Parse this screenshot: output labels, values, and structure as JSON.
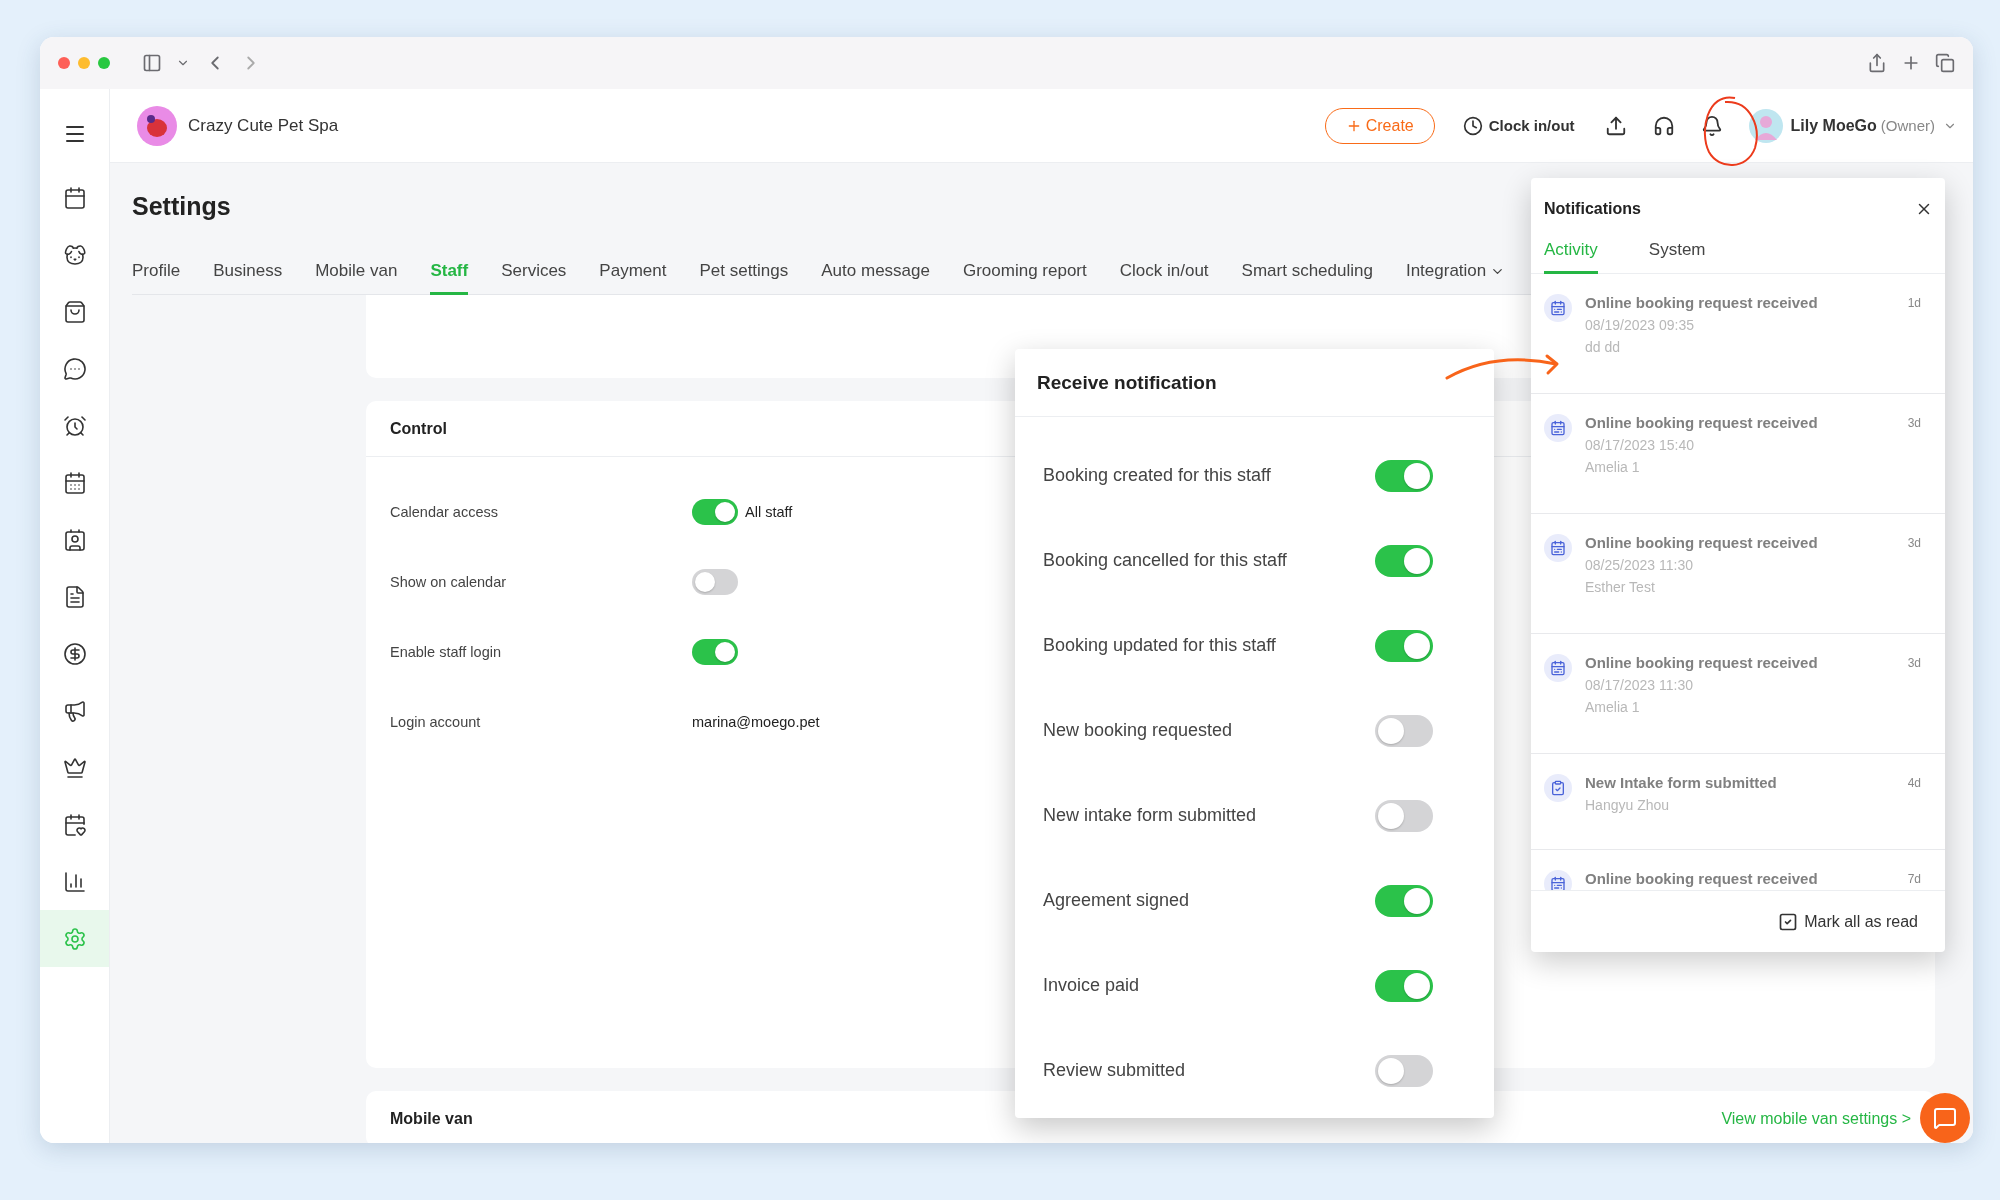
{
  "header": {
    "business_name": "Crazy Cute Pet Spa",
    "create_button": "Create",
    "clock_button": "Clock in/out",
    "user": {
      "name": "Lily MoeGo",
      "role": "(Owner)"
    }
  },
  "sidebar": {
    "items": [
      {
        "selected": false
      },
      {
        "selected": false
      },
      {
        "selected": false
      },
      {
        "selected": false
      },
      {
        "selected": false
      },
      {
        "selected": false
      },
      {
        "selected": false
      },
      {
        "selected": false
      },
      {
        "selected": false
      },
      {
        "selected": false
      },
      {
        "selected": false
      },
      {
        "selected": false
      },
      {
        "selected": false
      },
      {
        "selected": true
      }
    ]
  },
  "page": {
    "title": "Settings",
    "tabs": [
      {
        "label": "Profile",
        "selected": false
      },
      {
        "label": "Business",
        "selected": false
      },
      {
        "label": "Mobile van",
        "selected": false
      },
      {
        "label": "Staff",
        "selected": true
      },
      {
        "label": "Services",
        "selected": false
      },
      {
        "label": "Payment",
        "selected": false
      },
      {
        "label": "Pet settings",
        "selected": false
      },
      {
        "label": "Auto message",
        "selected": false
      },
      {
        "label": "Grooming report",
        "selected": false
      },
      {
        "label": "Clock in/out",
        "selected": false
      },
      {
        "label": "Smart scheduling",
        "selected": false
      },
      {
        "label": "Integration",
        "selected": false,
        "dropdown": true
      }
    ]
  },
  "control": {
    "title": "Control",
    "rows": [
      {
        "kind": "switch",
        "label": "Calendar access",
        "on": true,
        "value": "All staff"
      },
      {
        "kind": "switch",
        "label": "Show on calendar",
        "on": false
      },
      {
        "kind": "switch",
        "label": "Enable staff login",
        "on": true
      },
      {
        "kind": "text",
        "label": "Login account",
        "value": "marina@moego.pet"
      }
    ]
  },
  "mobile_van": {
    "title": "Mobile van",
    "link": "View mobile van settings >"
  },
  "receive_notification": {
    "title": "Receive notification",
    "items": [
      {
        "label": "Booking created for this staff",
        "on": true
      },
      {
        "label": "Booking cancelled for this staff",
        "on": true
      },
      {
        "label": "Booking updated for this staff",
        "on": true
      },
      {
        "label": "New booking requested",
        "on": false
      },
      {
        "label": "New intake form submitted",
        "on": false
      },
      {
        "label": "Agreement signed",
        "on": true
      },
      {
        "label": "Invoice paid",
        "on": true
      },
      {
        "label": "Review submitted",
        "on": false
      }
    ]
  },
  "notifications": {
    "title": "Notifications",
    "tabs": [
      {
        "label": "Activity",
        "selected": true
      },
      {
        "label": "System",
        "selected": false
      }
    ],
    "items": [
      {
        "kind": "booking",
        "title": "Online booking request received",
        "date": "08/19/2023 09:35",
        "detail": "dd dd",
        "age": "1d"
      },
      {
        "kind": "booking",
        "title": "Online booking request received",
        "date": "08/17/2023 15:40",
        "detail": "Amelia 1",
        "age": "3d"
      },
      {
        "kind": "booking",
        "title": "Online booking request received",
        "date": "08/25/2023 11:30",
        "detail": "Esther Test",
        "age": "3d"
      },
      {
        "kind": "booking",
        "title": "Online booking request received",
        "date": "08/17/2023 11:30",
        "detail": "Amelia 1",
        "age": "3d"
      },
      {
        "kind": "form",
        "title": "New Intake form submitted",
        "detail": "Hangyu Zhou",
        "age": "4d"
      },
      {
        "kind": "booking",
        "title": "Online booking request received",
        "age": "7d"
      }
    ],
    "mark_all_button": "Mark all as read"
  }
}
